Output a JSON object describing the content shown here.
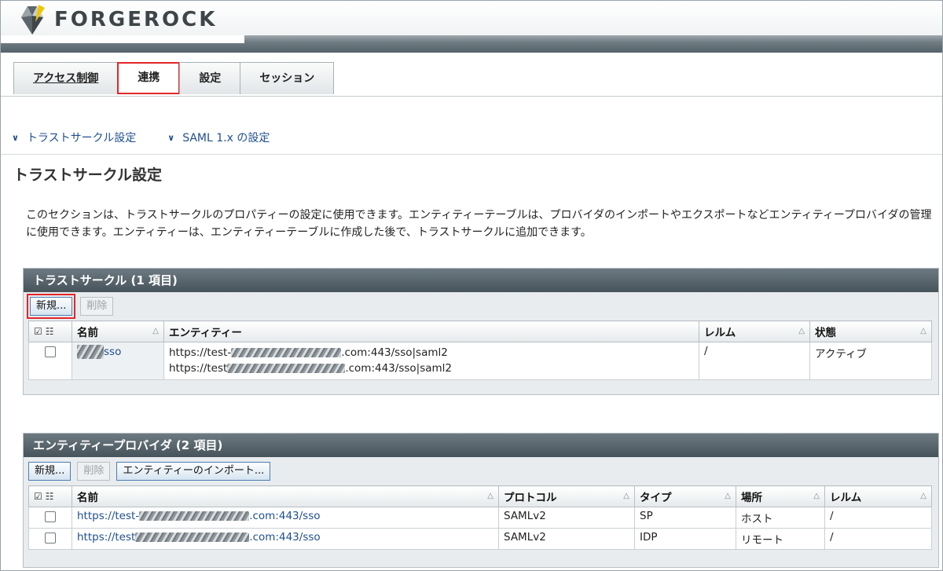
{
  "brand": {
    "name": "FORGEROCK"
  },
  "tabs": [
    {
      "label": "アクセス制御"
    },
    {
      "label": "連携"
    },
    {
      "label": "設定"
    },
    {
      "label": "セッション"
    }
  ],
  "sublinks": [
    {
      "label": "トラストサークル設定"
    },
    {
      "label": "SAML 1.x の設定"
    }
  ],
  "page": {
    "title": "トラストサークル設定",
    "description": "このセクションは、トラストサークルのプロパティーの設定に使用できます。エンティティーテーブルは、プロバイダのインポートやエクスポートなどエンティティープロバイダの管理に使用できます。エンティティーは、エンティティーテーブルに作成した後で、トラストサークルに追加できます。"
  },
  "cot_panel": {
    "title": "トラストサークル (1 項目)",
    "new_label": "新規...",
    "delete_label": "削除",
    "columns": {
      "name": "名前",
      "entity": "エンティティー",
      "realm": "レルム",
      "status": "状態"
    },
    "row": {
      "name_suffix": "sso",
      "entity_1_prefix": "https://test-",
      "entity_1_suffix": ".com:443/sso|saml2",
      "entity_2_prefix": "https://test",
      "entity_2_suffix": ".com:443/sso|saml2",
      "realm": "/",
      "status": "アクティブ"
    }
  },
  "ep_panel": {
    "title": "エンティティープロバイダ (2 項目)",
    "new_label": "新規...",
    "delete_label": "削除",
    "import_label": "エンティティーのインポート...",
    "columns": {
      "name": "名前",
      "protocol": "プロトコル",
      "type": "タイプ",
      "location": "場所",
      "realm": "レルム"
    },
    "rows": [
      {
        "name_prefix": "https://test-",
        "name_suffix": ".com:443/sso",
        "protocol": "SAMLv2",
        "type": "SP",
        "location": "ホスト",
        "realm": "/"
      },
      {
        "name_prefix": "https://test",
        "name_suffix": ".com:443/sso",
        "protocol": "SAMLv2",
        "type": "IDP",
        "location": "リモート",
        "realm": "/"
      }
    ]
  },
  "icons": {
    "checkbox_header": "select-all-icon",
    "sort": "sort-ascending-icon",
    "logo": "forgerock-logo-icon"
  },
  "colors": {
    "highlight": "#e2262a",
    "link": "#1f4f8f",
    "panel_header": "#46535b"
  }
}
